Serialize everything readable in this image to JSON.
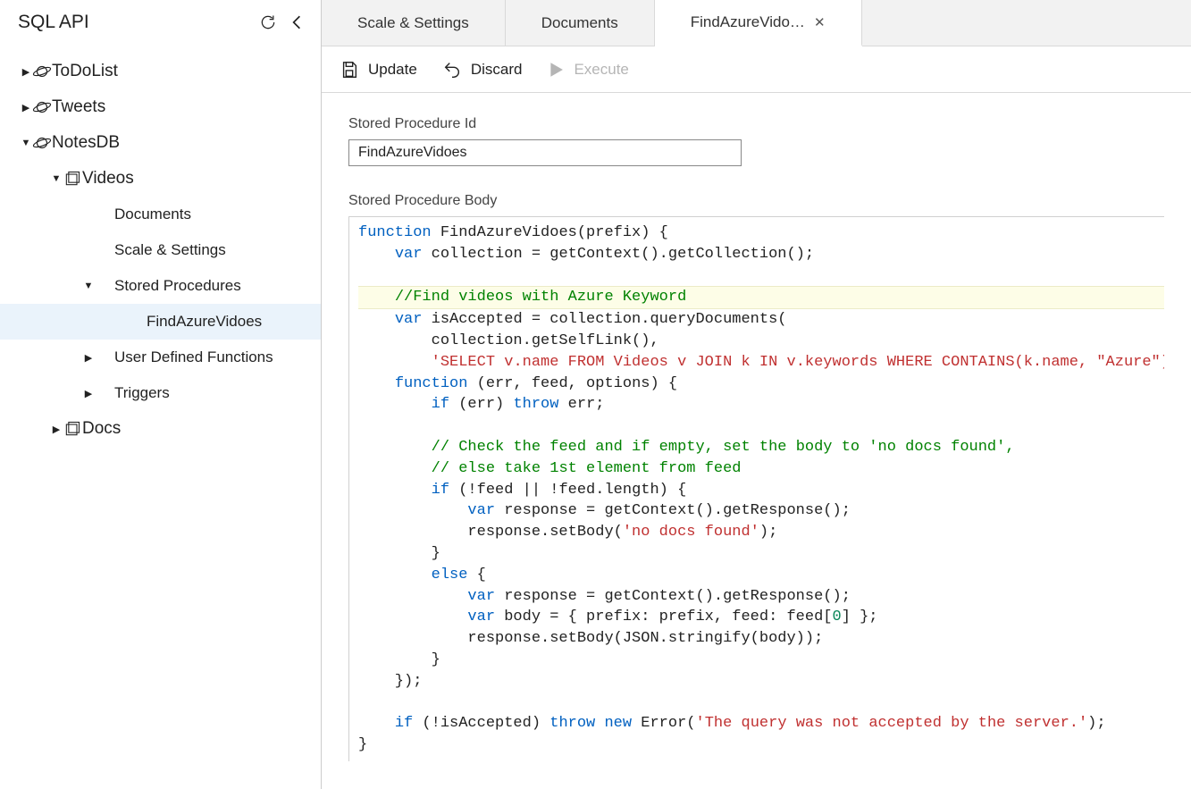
{
  "sidebar": {
    "title": "SQL API",
    "nodes": [
      {
        "label": "ToDoList",
        "depth": 0,
        "expanded": false,
        "icon": "planet"
      },
      {
        "label": "Tweets",
        "depth": 0,
        "expanded": false,
        "icon": "planet"
      },
      {
        "label": "NotesDB",
        "depth": 0,
        "expanded": true,
        "icon": "planet"
      },
      {
        "label": "Videos",
        "depth": 1,
        "expanded": true,
        "icon": "stack"
      },
      {
        "label": "Documents",
        "depth": 2,
        "leaf": true
      },
      {
        "label": "Scale & Settings",
        "depth": 2,
        "leaf": true
      },
      {
        "label": "Stored Procedures",
        "depth": 2,
        "expanded": true
      },
      {
        "label": "FindAzureVidoes",
        "depth": 3,
        "leaf": true,
        "selected": true
      },
      {
        "label": "User Defined Functions",
        "depth": 2,
        "expanded": false
      },
      {
        "label": "Triggers",
        "depth": 2,
        "expanded": false
      },
      {
        "label": "Docs",
        "depth": 1,
        "expanded": false,
        "icon": "stack"
      }
    ]
  },
  "tabs": [
    {
      "label": "Scale & Settings",
      "active": false,
      "closable": false
    },
    {
      "label": "Documents",
      "active": false,
      "closable": false
    },
    {
      "label": "FindAzureVido…",
      "active": true,
      "closable": true
    }
  ],
  "toolbar": {
    "update_label": "Update",
    "discard_label": "Discard",
    "execute_label": "Execute"
  },
  "form": {
    "id_label": "Stored Procedure Id",
    "id_value": "FindAzureVidoes",
    "body_label": "Stored Procedure Body"
  },
  "code_tokens": [
    [
      {
        "t": "function",
        "c": "kw"
      },
      {
        "t": " FindAzureVidoes(prefix) {"
      }
    ],
    [
      {
        "t": "    "
      },
      {
        "t": "var",
        "c": "kw"
      },
      {
        "t": " collection = getContext().getCollection();"
      }
    ],
    [
      {
        "t": ""
      }
    ],
    [
      {
        "t": "    "
      },
      {
        "t": "//Find videos with Azure Keyword",
        "c": "cm"
      }
    ],
    [
      {
        "t": "    "
      },
      {
        "t": "var",
        "c": "kw"
      },
      {
        "t": " isAccepted = collection.queryDocuments("
      }
    ],
    [
      {
        "t": "        collection.getSelfLink(),"
      }
    ],
    [
      {
        "t": "        "
      },
      {
        "t": "'SELECT v.name FROM Videos v JOIN k IN v.keywords WHERE CONTAINS(k.name, \"Azure\")'",
        "c": "str"
      },
      {
        "t": ","
      }
    ],
    [
      {
        "t": "    "
      },
      {
        "t": "function",
        "c": "kw"
      },
      {
        "t": " (err, feed, options) {"
      }
    ],
    [
      {
        "t": "        "
      },
      {
        "t": "if",
        "c": "kw"
      },
      {
        "t": " (err) "
      },
      {
        "t": "throw",
        "c": "kw"
      },
      {
        "t": " err;"
      }
    ],
    [
      {
        "t": ""
      }
    ],
    [
      {
        "t": "        "
      },
      {
        "t": "// Check the feed and if empty, set the body to 'no docs found',",
        "c": "cm"
      }
    ],
    [
      {
        "t": "        "
      },
      {
        "t": "// else take 1st element from feed",
        "c": "cm"
      }
    ],
    [
      {
        "t": "        "
      },
      {
        "t": "if",
        "c": "kw"
      },
      {
        "t": " (!feed || !feed.length) {"
      }
    ],
    [
      {
        "t": "            "
      },
      {
        "t": "var",
        "c": "kw"
      },
      {
        "t": " response = getContext().getResponse();"
      }
    ],
    [
      {
        "t": "            response.setBody("
      },
      {
        "t": "'no docs found'",
        "c": "str"
      },
      {
        "t": ");"
      }
    ],
    [
      {
        "t": "        }"
      }
    ],
    [
      {
        "t": "        "
      },
      {
        "t": "else",
        "c": "kw"
      },
      {
        "t": " {"
      }
    ],
    [
      {
        "t": "            "
      },
      {
        "t": "var",
        "c": "kw"
      },
      {
        "t": " response = getContext().getResponse();"
      }
    ],
    [
      {
        "t": "            "
      },
      {
        "t": "var",
        "c": "kw"
      },
      {
        "t": " body = { prefix: prefix, feed: feed["
      },
      {
        "t": "0",
        "c": "num"
      },
      {
        "t": "] };"
      }
    ],
    [
      {
        "t": "            response.setBody(JSON.stringify(body));"
      }
    ],
    [
      {
        "t": "        }"
      }
    ],
    [
      {
        "t": "    });"
      }
    ],
    [
      {
        "t": ""
      }
    ],
    [
      {
        "t": "    "
      },
      {
        "t": "if",
        "c": "kw"
      },
      {
        "t": " (!isAccepted) "
      },
      {
        "t": "throw",
        "c": "kw"
      },
      {
        "t": " "
      },
      {
        "t": "new",
        "c": "kw"
      },
      {
        "t": " Error("
      },
      {
        "t": "'The query was not accepted by the server.'",
        "c": "str"
      },
      {
        "t": ");"
      }
    ],
    [
      {
        "t": "}"
      }
    ]
  ],
  "highlighted_line_index": 3
}
